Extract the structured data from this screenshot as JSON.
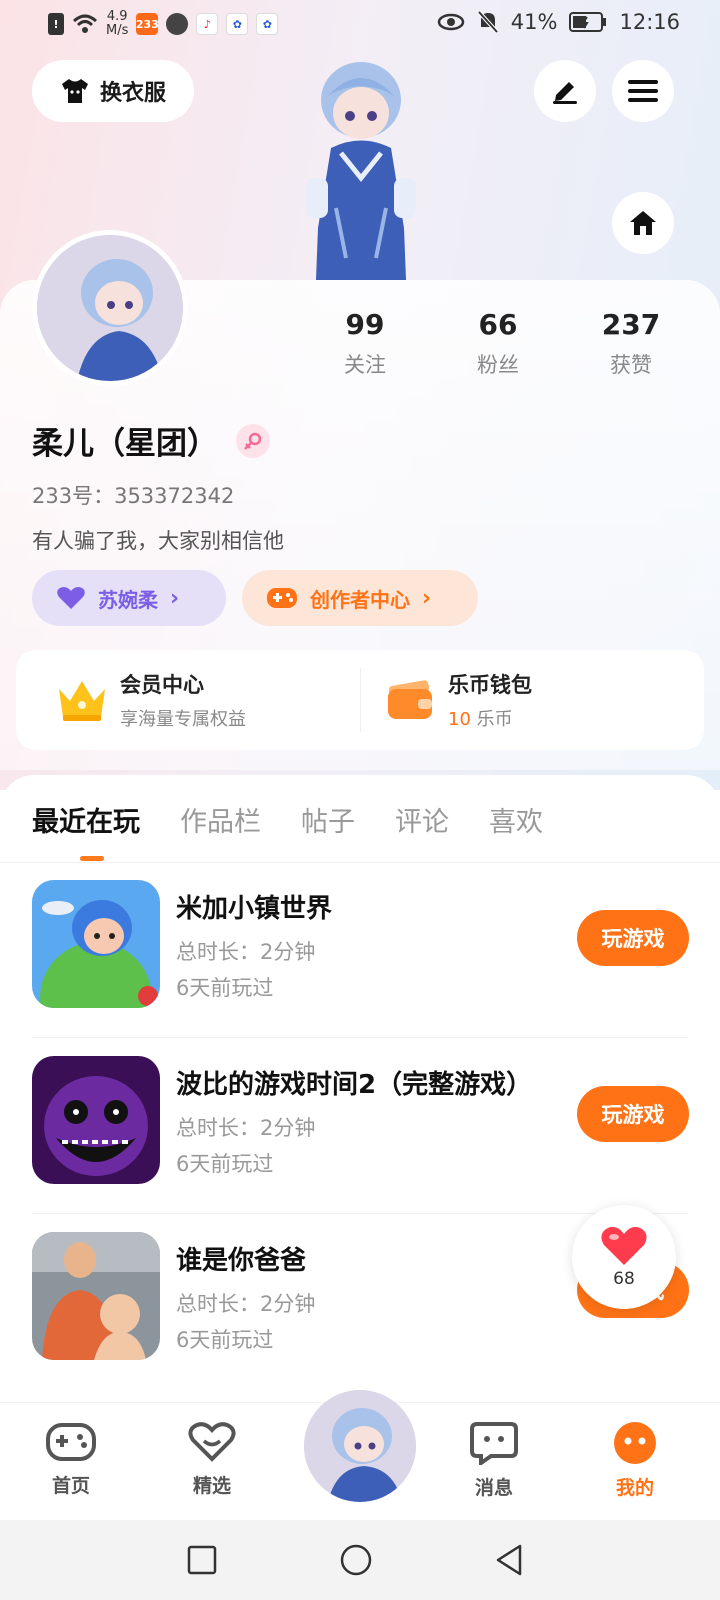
{
  "status_bar": {
    "net_speed_value": "4.9",
    "net_speed_unit": "M/s",
    "app_badge": "233",
    "battery": "41%",
    "time": "12:16"
  },
  "header": {
    "outfit_label": "换衣服"
  },
  "profile": {
    "nickname": "柔儿（星团）",
    "uid": "233号：353372342",
    "bio": "有人骗了我，大家别相信他",
    "stats": [
      {
        "value": "99",
        "label": "关注"
      },
      {
        "value": "66",
        "label": "粉丝"
      },
      {
        "value": "237",
        "label": "获赞"
      }
    ],
    "pills": {
      "friend_label": "苏婉柔",
      "creator_label": "创作者中心"
    }
  },
  "quick_card": {
    "vip_title": "会员中心",
    "vip_sub": "享海量专属权益",
    "wallet_title": "乐币钱包",
    "wallet_amount": "10",
    "wallet_unit": "乐币"
  },
  "tabs": [
    "最近在玩",
    "作品栏",
    "帖子",
    "评论",
    "喜欢"
  ],
  "games": [
    {
      "title": "米加小镇世界",
      "duration": "总时长：2分钟",
      "last": "6天前玩过",
      "button": "玩游戏"
    },
    {
      "title": "波比的游戏时间2（完整游戏）",
      "duration": "总时长：2分钟",
      "last": "6天前玩过",
      "button": "玩游戏"
    },
    {
      "title": "谁是你爸爸",
      "duration": "总时长：2分钟",
      "last": "6天前玩过",
      "button": "玩游戏"
    }
  ],
  "like_float": {
    "count": "68"
  },
  "bottom_nav": {
    "home": "首页",
    "featured": "精选",
    "messages": "消息",
    "mine": "我的"
  },
  "colors": {
    "accent": "#ff7316",
    "purple": "#7b5de6",
    "text_muted": "#999999"
  }
}
